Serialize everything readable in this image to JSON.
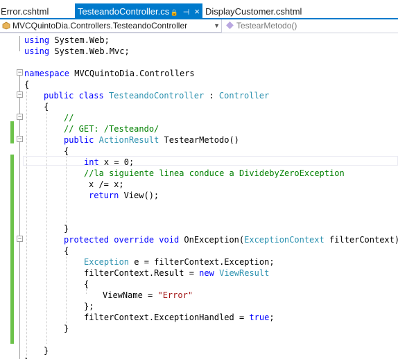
{
  "tabs": [
    {
      "label": "Error.cshtml",
      "active": false
    },
    {
      "label": "TesteandoController.cs",
      "active": true
    },
    {
      "label": "DisplayCustomer.cshtml",
      "active": false
    }
  ],
  "active_tab_icons": {
    "lock": "🔒",
    "pin": "⊣",
    "close": "×"
  },
  "navbar": {
    "class_path": "MVCQuintoDia.Controllers.TesteandoController",
    "member": "TestearMetodo()"
  },
  "colors": {
    "accent": "#007acc",
    "keyword": "#0000ff",
    "type": "#2b91af",
    "comment": "#008000",
    "string": "#a31515",
    "change_bar": "#6cc24a"
  },
  "code": {
    "l1": [
      "using",
      " System.Web;"
    ],
    "l2": [
      "using",
      " System.Web.Mvc;"
    ],
    "l3": [
      "namespace",
      " MVCQuintoDia.Controllers"
    ],
    "l4": "{",
    "l5": [
      "public",
      " ",
      "class",
      " ",
      "TesteandoController",
      " : ",
      "Controller"
    ],
    "l6": "{",
    "l7": "//",
    "l8": "// GET: /Testeando/",
    "l9": [
      "public",
      " ",
      "ActionResult",
      " TestearMetodo()"
    ],
    "l10": "{",
    "l11": [
      "int",
      " x = 0;"
    ],
    "l12": "//la siguiente linea conduce a DividebyZeroException",
    "l13": "x /= x;",
    "l14": [
      "return",
      " View();"
    ],
    "l15": "}",
    "l16": [
      "protected",
      " ",
      "override",
      " ",
      "void",
      " OnException(",
      "ExceptionContext",
      " filterContext)"
    ],
    "l17": "{",
    "l18": [
      "Exception",
      " e = filterContext.Exception;"
    ],
    "l19": [
      "filterContext.Result = ",
      "new",
      " ",
      "ViewResult"
    ],
    "l20": "{",
    "l21": [
      "ViewName = ",
      "\"Error\""
    ],
    "l22": "};",
    "l23": [
      "filterContext.ExceptionHandled = ",
      "true",
      ";"
    ],
    "l24": "}",
    "l25": "}",
    "l26": "}"
  }
}
